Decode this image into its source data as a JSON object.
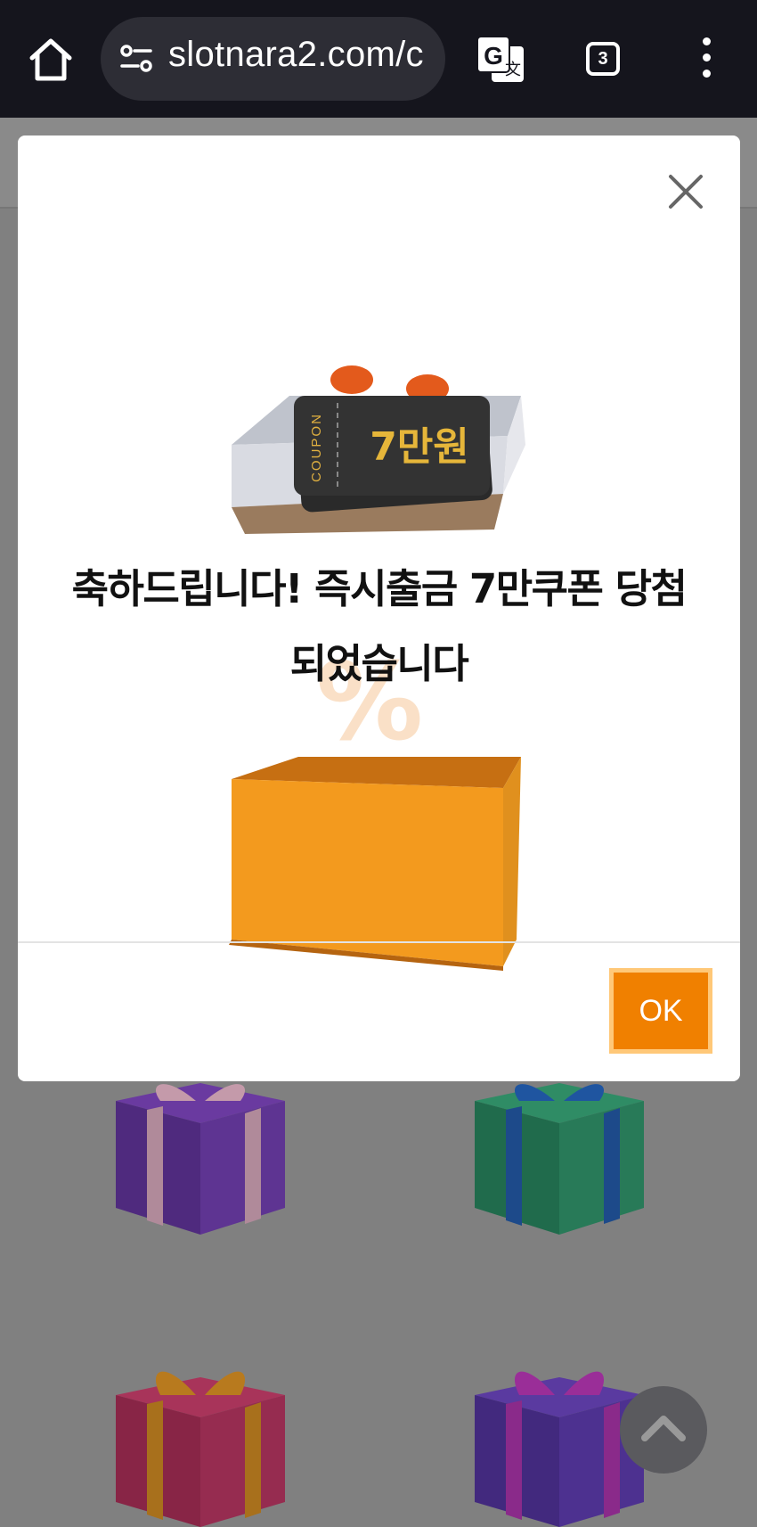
{
  "browser": {
    "url": "slotnara2.com/c",
    "tab_count": "3"
  },
  "modal": {
    "message_line1": "축하드립니다! 즉시출금 7만쿠폰 당첨",
    "message_line2": "되었습니다",
    "coupon_label": "COUPON",
    "coupon_amount": "7만원",
    "ok_label": "OK"
  },
  "colors": {
    "accent": "#f08000",
    "topbar": "#15151d"
  }
}
